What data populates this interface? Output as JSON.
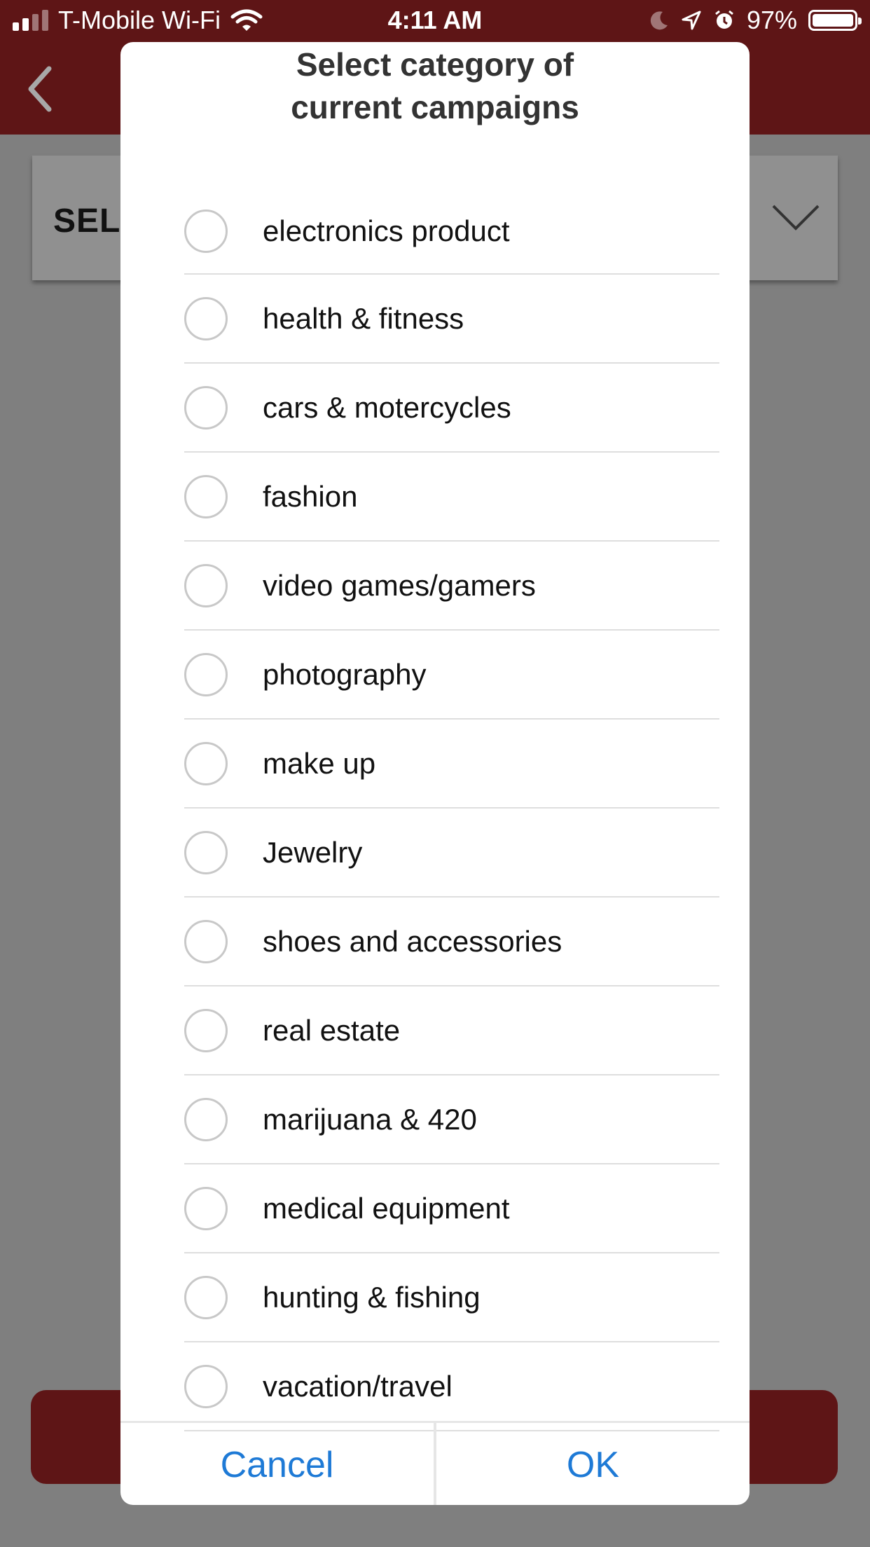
{
  "status_bar": {
    "carrier": "T-Mobile Wi-Fi",
    "time": "4:11 AM",
    "battery": "97%",
    "icons": [
      "signal-icon",
      "wifi-icon",
      "moon-icon",
      "location-arrow-icon",
      "alarm-icon",
      "battery-icon"
    ]
  },
  "background": {
    "select_text": "SEL",
    "header_color": "#5e1516"
  },
  "dialog": {
    "title_line1": "Select category of",
    "title_line2": "current campaigns",
    "options": [
      "electronics product",
      "health & fitness",
      "cars & motercycles",
      "fashion",
      "video games/gamers",
      "photography",
      "make up",
      "Jewelry",
      "shoes and accessories",
      "real estate",
      "marijuana & 420",
      "medical equipment",
      "hunting & fishing",
      "vacation/travel"
    ],
    "cancel_label": "Cancel",
    "ok_label": "OK",
    "accent_color": "#1e7ad6"
  }
}
